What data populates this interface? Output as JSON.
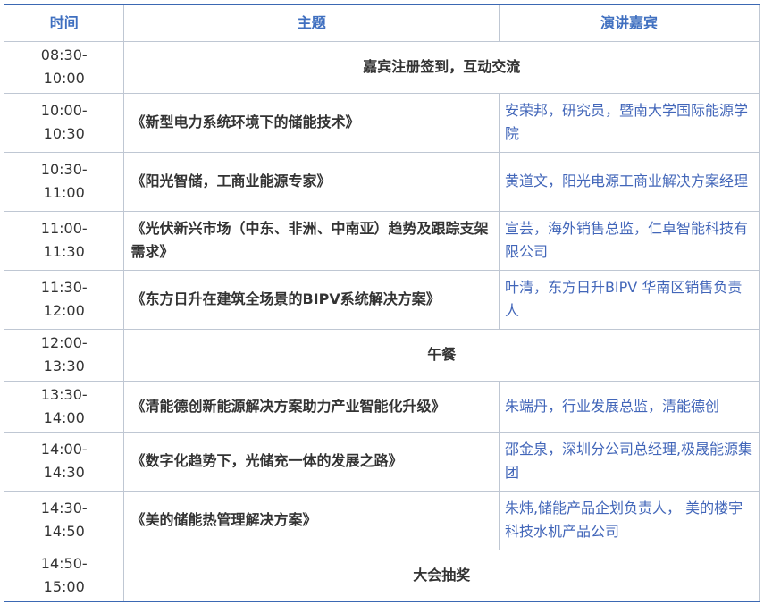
{
  "header": {
    "time": "时间",
    "topic": "主题",
    "speaker": "演讲嘉宾"
  },
  "rows": [
    {
      "start": "08:30-",
      "end": "10:00",
      "span": "嘉宾注册签到，互动交流"
    },
    {
      "start": "10:00-",
      "end": "10:30",
      "topic": "《新型电力系统环境下的储能技术》",
      "speaker": "安荣邦，研究员，暨南大学国际能源学院"
    },
    {
      "start": "10:30-",
      "end": "11:00",
      "topic": "《阳光智储，工商业能源专家》",
      "speaker": "黄道文，阳光电源工商业解决方案经理"
    },
    {
      "start": "11:00-",
      "end": "11:30",
      "topic": "《光伏新兴市场（中东、非洲、中南亚）趋势及跟踪支架需求》",
      "speaker": "宣芸，海外销售总监，仁卓智能科技有限公司"
    },
    {
      "start": "11:30-",
      "end": "12:00",
      "topic": "《东方日升在建筑全场景的BIPV系统解决方案》",
      "speaker": "叶清，东方日升BIPV 华南区销售负责人"
    },
    {
      "start": "12:00-",
      "end": "13:30",
      "span": "午餐"
    },
    {
      "start": "13:30-",
      "end": "14:00",
      "topic": "《清能德创新能源解决方案助力产业智能化升级》",
      "speaker": "朱端丹，行业发展总监，清能德创"
    },
    {
      "start": "14:00-",
      "end": "14:30",
      "topic": "《数字化趋势下，光储充一体的发展之路》",
      "speaker": "邵金泉，深圳分公司总经理,极晟能源集团"
    },
    {
      "start": "14:30-",
      "end": "14:50",
      "topic": "《美的储能热管理解决方案》",
      "speaker": "朱炜,储能产品企划负责人， 美的楼宇科技水机产品公司"
    },
    {
      "start": "14:50-",
      "end": "15:00",
      "span": "大会抽奖"
    }
  ]
}
